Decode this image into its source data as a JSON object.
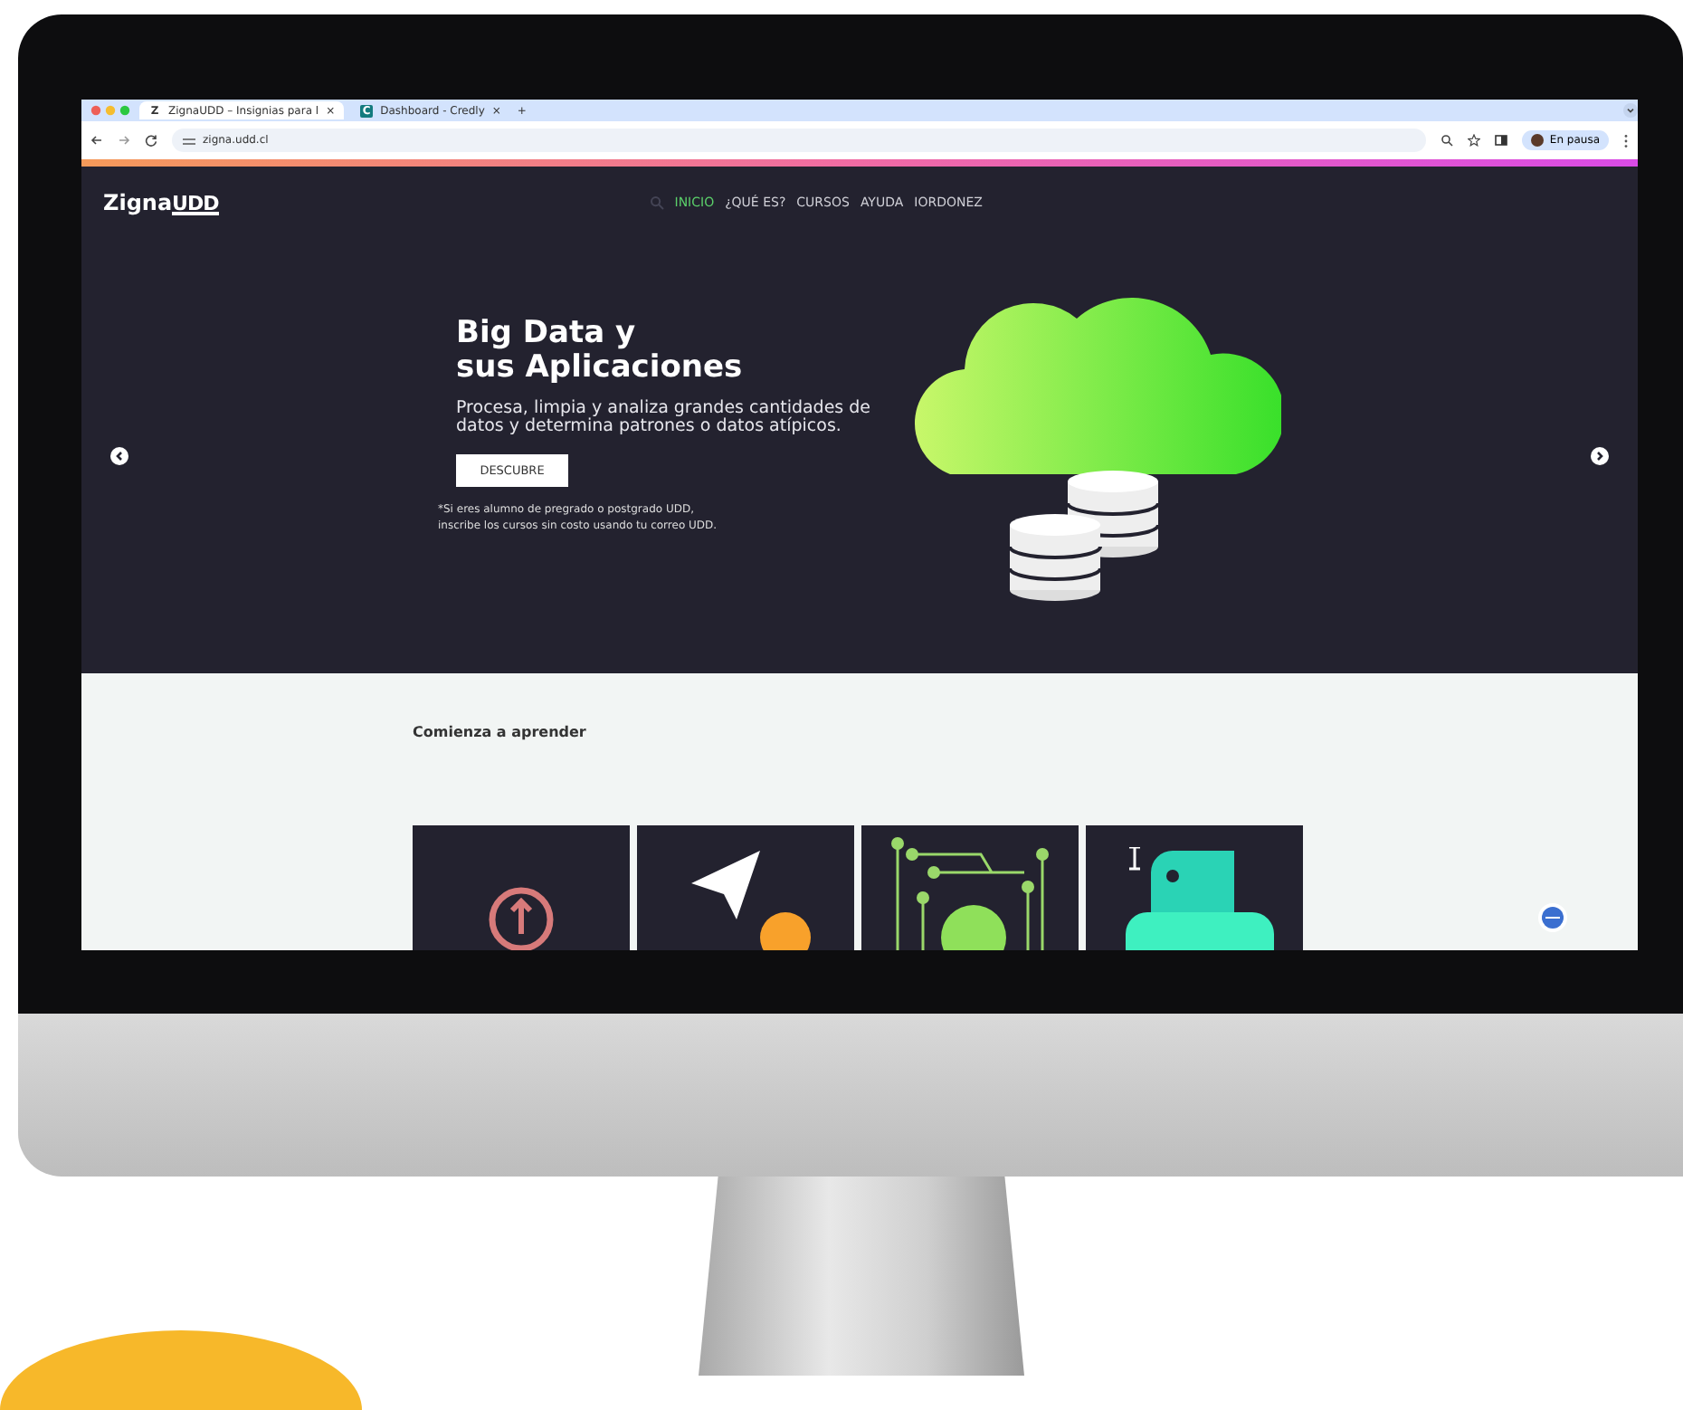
{
  "browser": {
    "tabs": [
      {
        "icon": "Z",
        "title": "ZignaUDD – Insignias para l",
        "close": "×",
        "selected": true
      },
      {
        "icon": "C",
        "title": "Dashboard - Credly",
        "close": "×",
        "selected": false
      }
    ],
    "new_tab": "+",
    "url": "zigna.udd.cl",
    "profile": "En pausa"
  },
  "header": {
    "logo": "Zigna",
    "logo_mark": "UDD",
    "nav": [
      {
        "label": "INICIO",
        "selected": true
      },
      {
        "label": "¿QUÉ ES?",
        "selected": false
      },
      {
        "label": "CURSOS",
        "selected": false
      },
      {
        "label": "AYUDA",
        "selected": false
      },
      {
        "label": "IORDONEZ",
        "selected": false
      }
    ]
  },
  "hero": {
    "title_lines": [
      "Big Data y",
      "sus Aplicaciones"
    ],
    "description": "Procesa, limpia y analiza grandes cantidades de datos y determina patrones o datos atípicos.",
    "button": "DESCUBRE",
    "note_lines": [
      "*Si eres alumno de pregrado o postgrado UDD,",
      "inscribe los cursos sin costo usando tu correo UDD."
    ]
  },
  "courses": {
    "heading": "Comienza a aprender",
    "cards": [
      {
        "kind": "power"
      },
      {
        "kind": "plane"
      },
      {
        "kind": "coin"
      },
      {
        "kind": "python"
      }
    ]
  }
}
